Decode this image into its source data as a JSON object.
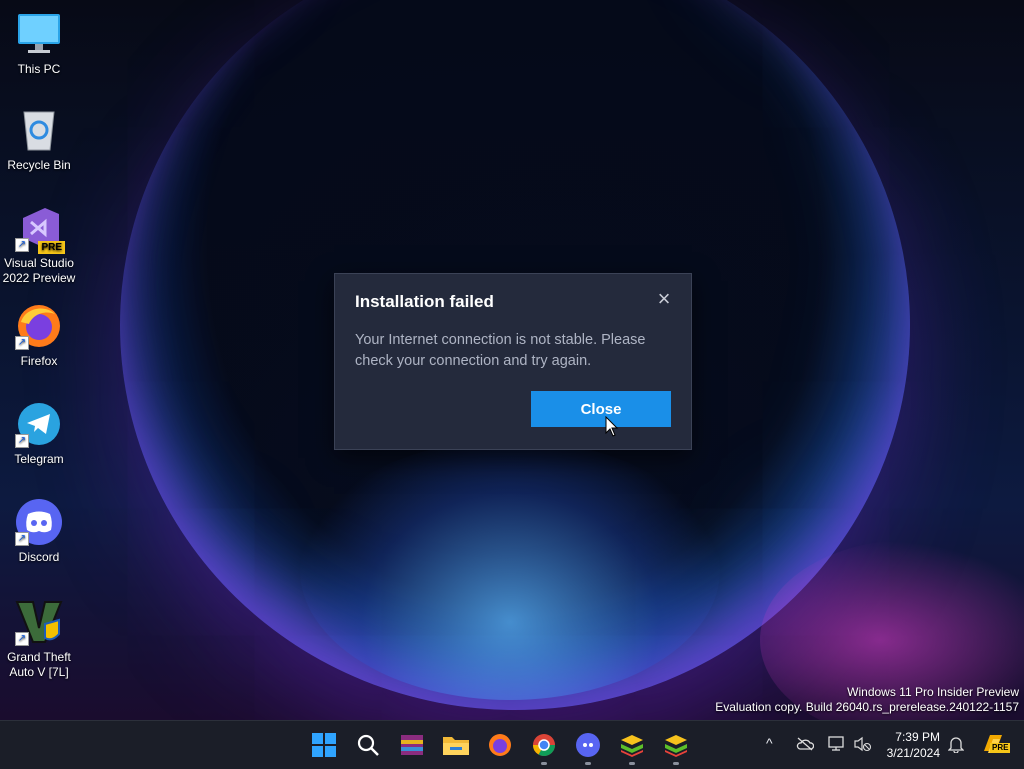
{
  "desktop": {
    "icons": [
      {
        "label": "This PC"
      },
      {
        "label": "Recycle Bin"
      },
      {
        "label": "Visual Studio 2022 Preview",
        "badge": "PRE"
      },
      {
        "label": "Firefox"
      },
      {
        "label": "Telegram"
      },
      {
        "label": "Discord"
      },
      {
        "label": "Grand Theft Auto V [7L]"
      }
    ]
  },
  "dialog": {
    "title": "Installation failed",
    "message": "Your Internet connection is not stable. Please check your connection and try again.",
    "close_button": "Close",
    "close_icon": "×"
  },
  "watermark": {
    "line1": "Windows 11 Pro Insider Preview",
    "line2": "Evaluation copy. Build 26040.rs_prerelease.240122-1157"
  },
  "taskbar": {
    "apps": [
      "start-icon",
      "search-icon",
      "winrar-icon",
      "file-explorer-icon",
      "firefox-icon",
      "chrome-icon",
      "discord-icon",
      "bluestacks-icon",
      "bluestacks-icon"
    ],
    "tray_chevron": "^",
    "time": "7:39 PM",
    "date": "3/21/2024",
    "copilot_badge": "PRE"
  },
  "colors": {
    "accent": "#1a8fe8",
    "dialog_bg": "#242a3c",
    "taskbar_bg": "#1b1e28"
  }
}
